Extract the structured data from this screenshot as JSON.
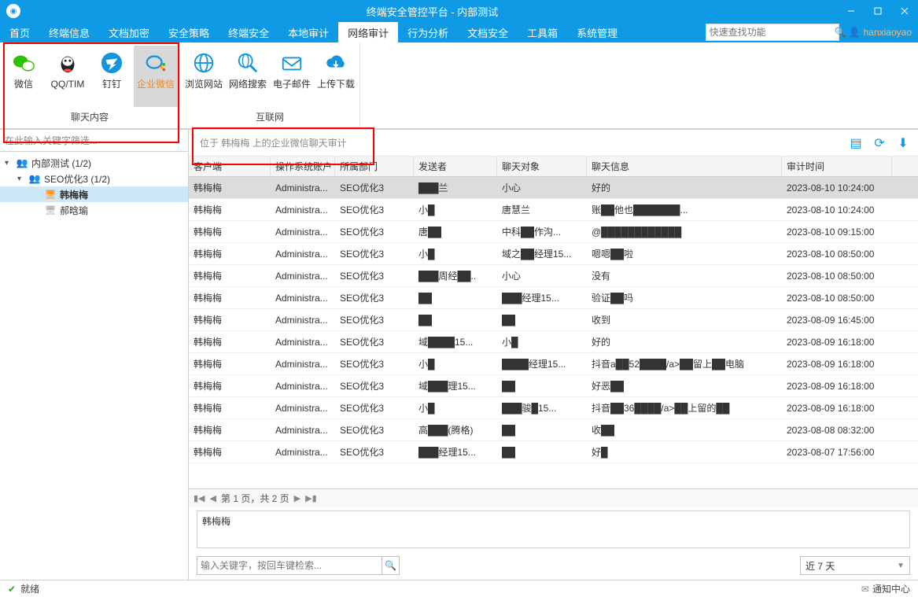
{
  "window": {
    "title": "终端安全管控平台 - 内部测试"
  },
  "menu": {
    "tabs": [
      "首页",
      "终端信息",
      "文档加密",
      "安全策略",
      "终端安全",
      "本地审计",
      "网络审计",
      "行为分析",
      "文档安全",
      "工具箱",
      "系统管理"
    ],
    "active_index": 6,
    "search_placeholder": "快速查找功能",
    "user_name": "hanxiaoyao"
  },
  "ribbon": {
    "group1": {
      "label": "聊天内容",
      "items": [
        {
          "label": "微信",
          "icon": "wechat",
          "sel": false,
          "color": "#2dc100"
        },
        {
          "label": "QQ/TIM",
          "icon": "qq",
          "sel": false,
          "color": "#222"
        },
        {
          "label": "钉钉",
          "icon": "dingtalk",
          "sel": false,
          "color": "#1296db"
        },
        {
          "label": "企业微信",
          "icon": "workweixin",
          "sel": true,
          "color": "#1296db"
        }
      ]
    },
    "group2": {
      "label": "互联网",
      "items": [
        {
          "label": "浏览网站",
          "icon": "globe",
          "color": "#1296db"
        },
        {
          "label": "网络搜索",
          "icon": "search-globe",
          "color": "#1296db"
        },
        {
          "label": "电子邮件",
          "icon": "mail",
          "color": "#1296db"
        },
        {
          "label": "上传下载",
          "icon": "cloud",
          "color": "#1296db"
        }
      ]
    }
  },
  "tree": {
    "filter_placeholder": "在此输入关键字筛选...",
    "root": {
      "label": "内部测试 (1/2)"
    },
    "child": {
      "label": "SEO优化3 (1/2)"
    },
    "leaves": [
      {
        "label": "韩梅梅",
        "sel": true,
        "online": true
      },
      {
        "label": "郝晗瑜",
        "sel": false,
        "online": false
      }
    ]
  },
  "content": {
    "crumb": "位于 韩梅梅 上的企业微信聊天审计",
    "columns": [
      "客户端",
      "操作系统账户",
      "所属部门",
      "发送者",
      "聊天对象",
      "聊天信息",
      "审计时间"
    ],
    "rows": [
      {
        "c0": "韩梅梅",
        "c1": "Administra...",
        "c2": "SEO优化3",
        "c3": "███兰",
        "c4": "小心",
        "c5": "好的",
        "c6": "2023-08-10 10:24:00"
      },
      {
        "c0": "韩梅梅",
        "c1": "Administra...",
        "c2": "SEO优化3",
        "c3": "小█",
        "c4": "唐慧兰",
        "c5": "账██他也███████...",
        "c6": "2023-08-10 10:24:00"
      },
      {
        "c0": "韩梅梅",
        "c1": "Administra...",
        "c2": "SEO优化3",
        "c3": "唐██",
        "c4": "中科██作沟...",
        "c5": "@████████████",
        "c6": "2023-08-10 09:15:00"
      },
      {
        "c0": "韩梅梅",
        "c1": "Administra...",
        "c2": "SEO优化3",
        "c3": "小█",
        "c4": "域之██经理15...",
        "c5": "嗯嗯██啦",
        "c6": "2023-08-10 08:50:00"
      },
      {
        "c0": "韩梅梅",
        "c1": "Administra...",
        "c2": "SEO优化3",
        "c3": "███周经██..",
        "c4": "小心",
        "c5": "没有",
        "c6": "2023-08-10 08:50:00"
      },
      {
        "c0": "韩梅梅",
        "c1": "Administra...",
        "c2": "SEO优化3",
        "c3": "██",
        "c4": "███经理15...",
        "c5": "验证██吗",
        "c6": "2023-08-10 08:50:00"
      },
      {
        "c0": "韩梅梅",
        "c1": "Administra...",
        "c2": "SEO优化3",
        "c3": "██",
        "c4": "██",
        "c5": "收到",
        "c6": "2023-08-09 16:45:00"
      },
      {
        "c0": "韩梅梅",
        "c1": "Administra...",
        "c2": "SEO优化3",
        "c3": "域████15...",
        "c4": "小█",
        "c5": "好的",
        "c6": "2023-08-09 16:18:00"
      },
      {
        "c0": "韩梅梅",
        "c1": "Administra...",
        "c2": "SEO优化3",
        "c3": "小█",
        "c4": "████经理15...",
        "c5": "抖音a██52████/a>██留上██电脑",
        "c6": "2023-08-09 16:18:00"
      },
      {
        "c0": "韩梅梅",
        "c1": "Administra...",
        "c2": "SEO优化3",
        "c3": "域███理15...",
        "c4": "██",
        "c5": "好恶██",
        "c6": "2023-08-09 16:18:00"
      },
      {
        "c0": "韩梅梅",
        "c1": "Administra...",
        "c2": "SEO优化3",
        "c3": "小█",
        "c4": "███骏█15...",
        "c5": "抖音██36████/a>██上留的██",
        "c6": "2023-08-09 16:18:00"
      },
      {
        "c0": "韩梅梅",
        "c1": "Administra...",
        "c2": "SEO优化3",
        "c3": "高███(腾格)",
        "c4": "██",
        "c5": "收██",
        "c6": "2023-08-08 08:32:00"
      },
      {
        "c0": "韩梅梅",
        "c1": "Administra...",
        "c2": "SEO优化3",
        "c3": "███经理15...",
        "c4": "██",
        "c5": "好█",
        "c6": "2023-08-07 17:56:00"
      }
    ],
    "pager": "第 1 页，共 2 页",
    "detail": "韩梅梅",
    "keyword_placeholder": "输入关键字，按回车键检索...",
    "range": "近 7 天"
  },
  "status": {
    "text": "就绪",
    "notify": "通知中心"
  }
}
